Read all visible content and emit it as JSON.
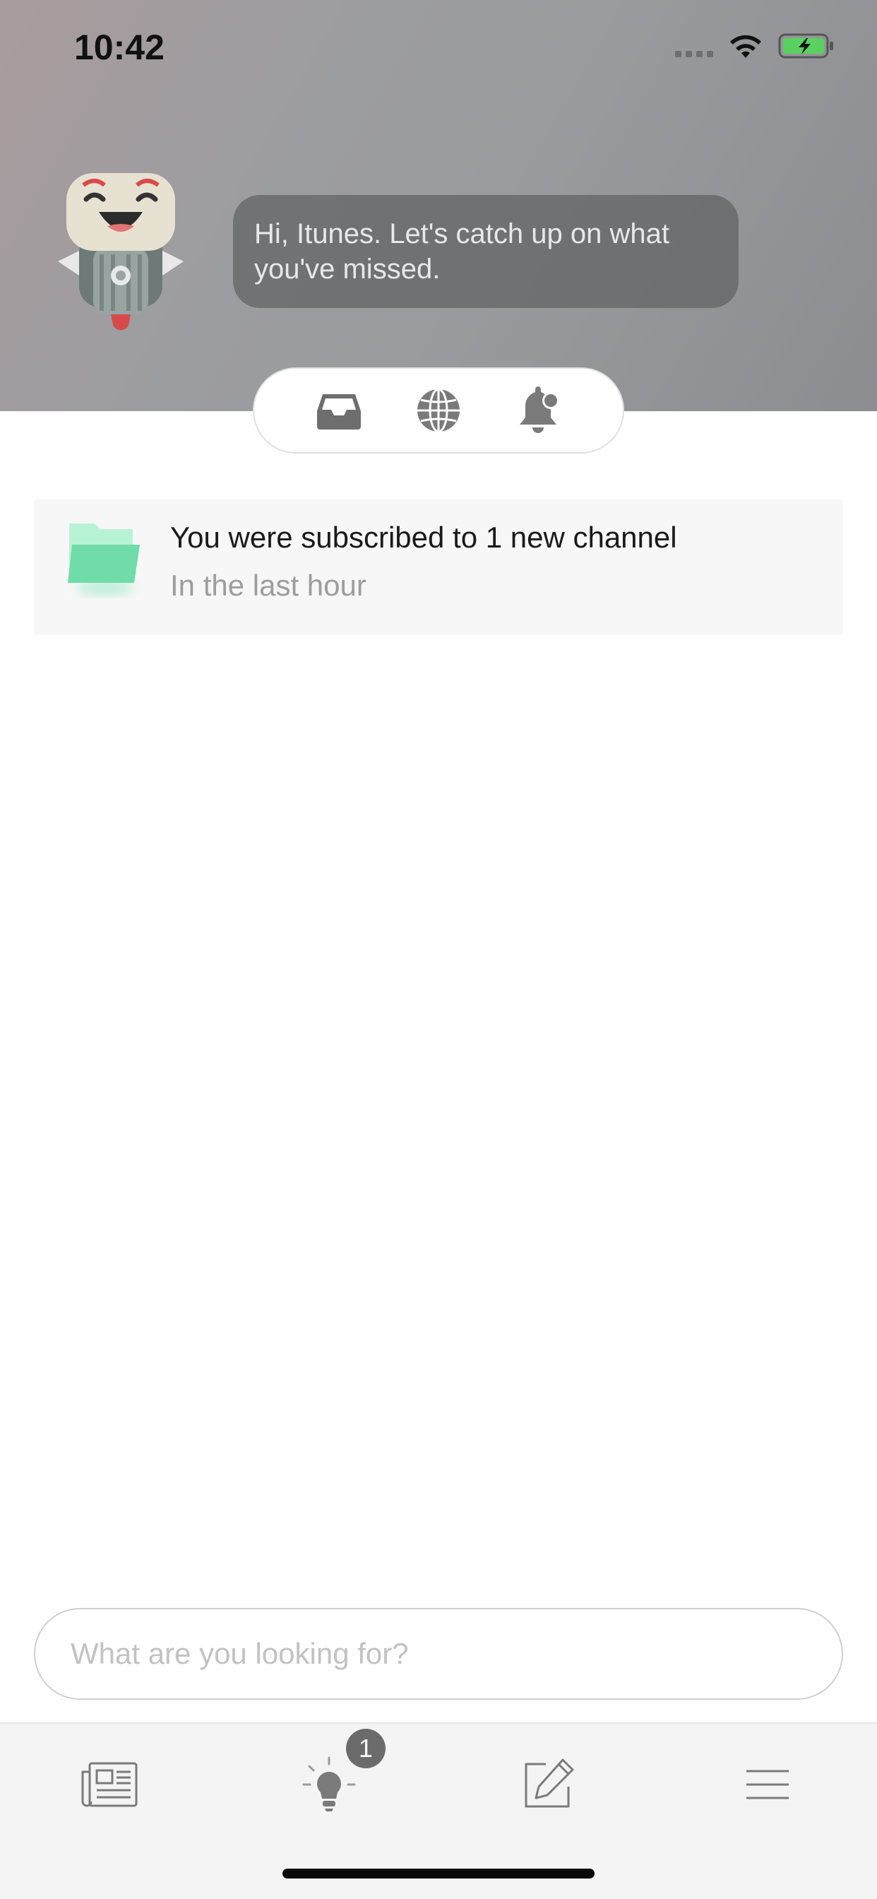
{
  "status_bar": {
    "time": "10:42"
  },
  "greeting": {
    "message": "Hi, Itunes. Let's catch up on what you've missed."
  },
  "tabs": [
    {
      "icon": "inbox-icon"
    },
    {
      "icon": "globe-icon"
    },
    {
      "icon": "bell-icon"
    }
  ],
  "notification": {
    "title": "You were subscribed to 1 new channel",
    "subtitle": "In the last hour",
    "icon": "folder-icon"
  },
  "search": {
    "placeholder": "What are you looking for?",
    "value": ""
  },
  "tab_bar": {
    "items": [
      {
        "icon": "newspaper-icon"
      },
      {
        "icon": "lightbulb-icon",
        "badge": "1"
      },
      {
        "icon": "compose-icon"
      },
      {
        "icon": "menu-icon"
      }
    ]
  },
  "colors": {
    "header_gray": "#9c9da0",
    "folder_green": "#6fdcaa",
    "icon_gray": "#7a7a7a"
  }
}
